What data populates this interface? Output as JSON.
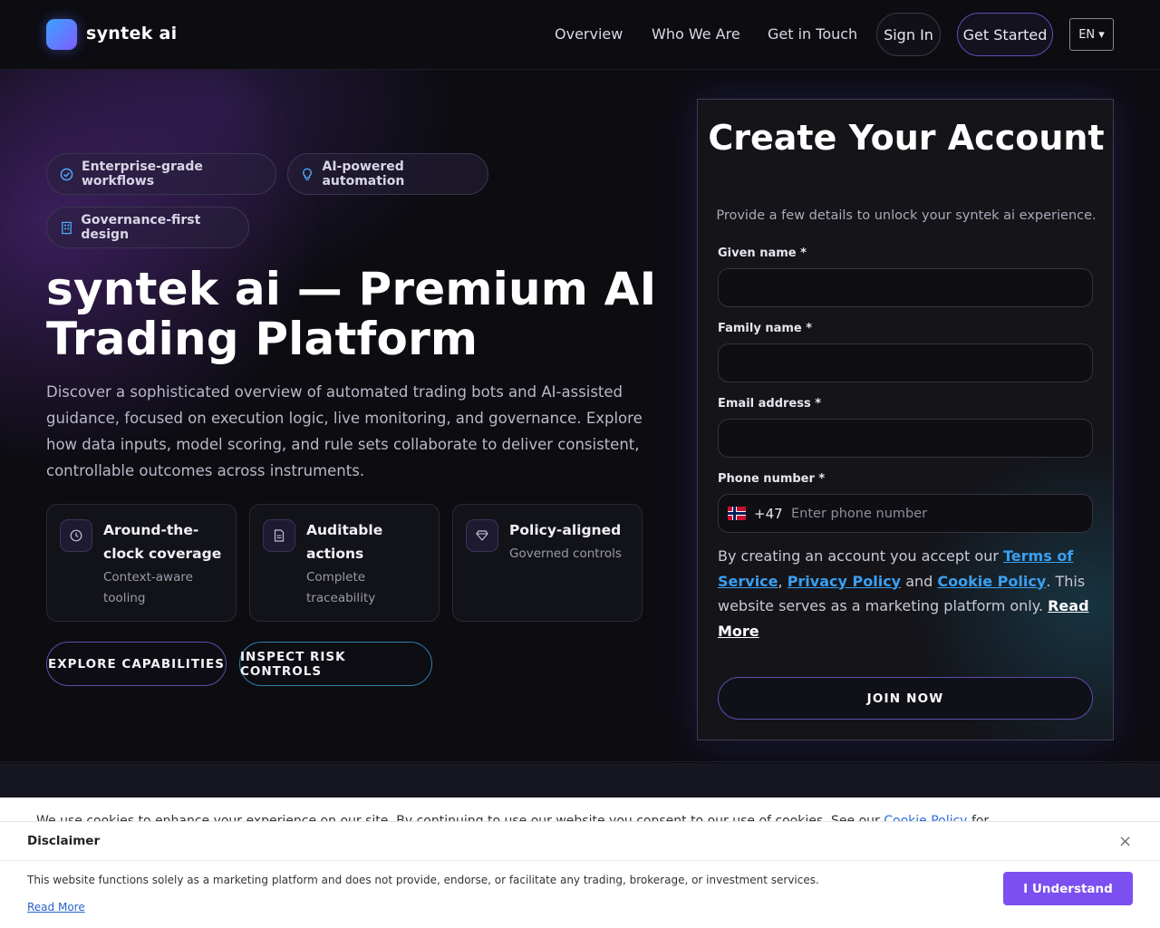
{
  "brand": {
    "name": "syntek ai"
  },
  "nav": {
    "links": [
      "Overview",
      "Who We Are",
      "Get in Touch"
    ],
    "sign_in": "Sign In",
    "get_started": "Get Started",
    "language": "EN ▾"
  },
  "hero": {
    "tags": [
      "Enterprise-grade workflows",
      "AI-powered automation",
      "Governance-first design"
    ],
    "title": "syntek ai — Premium AI Trading Platform",
    "description": "Discover a sophisticated overview of automated trading bots and AI-assisted guidance, focused on execution logic, live monitoring, and governance. Explore how data inputs, model scoring, and rule sets collaborate to deliver consistent, controllable outcomes across instruments.",
    "features": [
      {
        "title": "Around-the-clock coverage",
        "subtitle": "Context-aware tooling",
        "icon": "clock-icon"
      },
      {
        "title": "Auditable actions",
        "subtitle": "Complete traceability",
        "icon": "document-icon"
      },
      {
        "title": "Policy-aligned",
        "subtitle": "Governed controls",
        "icon": "diamond-icon"
      }
    ],
    "cta_primary": "EXPLORE CAPABILITIES",
    "cta_secondary": "INSPECT RISK CONTROLS"
  },
  "signup": {
    "title": "Create Your Account",
    "subtitle": "Provide a few details to unlock your syntek ai experience.",
    "given_name_label": "Given name *",
    "given_name_value": "",
    "family_name_label": "Family name *",
    "family_name_value": "",
    "email_label": "Email address *",
    "email_value": "",
    "phone_label": "Phone number *",
    "phone_dial_code": "+47",
    "phone_placeholder": "Enter phone number",
    "terms_prefix": "By creating an account you accept our",
    "terms_link": "Terms of Service",
    "privacy_link": "Privacy Policy",
    "and_text": "and",
    "cookie_link": "Cookie Policy",
    "terms_suffix": ". This website serves as a marketing platform only.",
    "read_more": "Read More",
    "submit": "JOIN NOW"
  },
  "cookie_strip": {
    "text_start": "We use cookies to enhance your experience on our site. By continuing to use our website you consent to our use of cookies. See our",
    "link": "Cookie Policy",
    "text_end": "for"
  },
  "disclaimer": {
    "title": "Disclaimer",
    "close": "×",
    "text": "This website functions solely as a marketing platform and does not provide, endorse, or facilitate any trading, brokerage, or investment services.",
    "read_more": "Read More",
    "button": "I Understand"
  },
  "colors": {
    "accent_purple": "#7b4ff0",
    "link_blue": "#3aa0f2",
    "background": "#0c0c11"
  }
}
